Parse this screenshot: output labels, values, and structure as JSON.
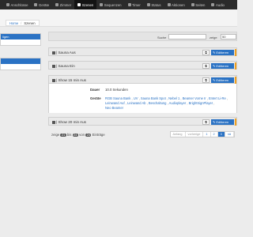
{
  "nav": {
    "items": [
      {
        "label": "Anschlüsse",
        "active": false
      },
      {
        "label": "Geräte",
        "active": false
      },
      {
        "label": "Zimmer",
        "active": false
      },
      {
        "label": "Szenen",
        "active": true
      },
      {
        "label": "Sequenzen",
        "active": false
      },
      {
        "label": "Timer",
        "active": false
      },
      {
        "label": "Status",
        "active": false
      },
      {
        "label": "Aktionen",
        "active": false
      },
      {
        "label": "Seiten",
        "active": false
      },
      {
        "label": "Audio",
        "active": false
      }
    ]
  },
  "breadcrumb": {
    "home": "Home",
    "separator": "/",
    "current": "Szenen"
  },
  "sidebar": {
    "panel1_label": "ligen"
  },
  "toolbar": {
    "search_label": "Suche",
    "search_value": "",
    "show_label": "zeige",
    "show_value": "50"
  },
  "rows": [
    {
      "title": "| Sauna Aus",
      "edit_label": "Editieren"
    },
    {
      "title": "| Sauna Ein",
      "edit_label": "Editieren"
    },
    {
      "title": "| Show 15 min Aus",
      "edit_label": "Editieren"
    },
    {
      "title": "| Show 20 min Aus",
      "edit_label": "Editieren"
    }
  ],
  "detail": {
    "duration_label": "Dauer",
    "duration_value": "10.0 Sekunden",
    "devices_label": "Geräte",
    "devices": [
      "RGB Sauna Bank",
      "UV",
      "Sauna Bank Spot",
      "Nebel 1",
      "Beamer Vorne Ir",
      "Entert Li-Re",
      "Leinwand Auf",
      "Leinwand Ab",
      "Beschaltung",
      "Audioplayer",
      "BrightSignPlayer",
      "Neo Beamer"
    ]
  },
  "footer": {
    "prefix": "zeige",
    "from": "21",
    "mid1": "bis",
    "to": "24",
    "mid2": "von",
    "total": "24",
    "suffix": "Einträge",
    "pages": [
      {
        "label": "Anfang",
        "state": "muted"
      },
      {
        "label": "vorherige",
        "state": "muted"
      },
      {
        "label": "1",
        "state": "normal"
      },
      {
        "label": "2",
        "state": "normal"
      },
      {
        "label": "3",
        "state": "active"
      },
      {
        "label": "nä",
        "state": "normal"
      }
    ]
  },
  "colors": {
    "accent": "#2a72c4",
    "nav_bg": "#2b2b2b",
    "highlight": "#f0a020"
  }
}
